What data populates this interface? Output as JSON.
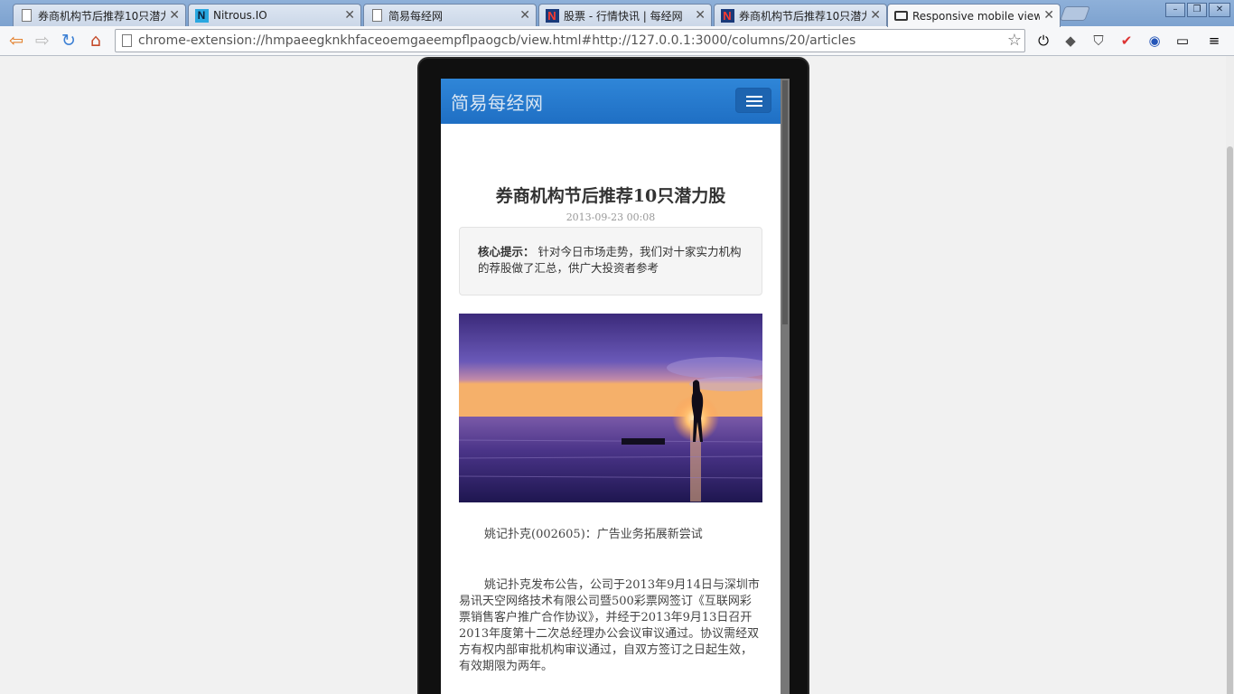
{
  "tabs": [
    {
      "title": "券商机构节后推荐10只潜力",
      "favicon": "page-icon"
    },
    {
      "title": "Nitrous.IO",
      "favicon": "nitrous-icon"
    },
    {
      "title": "简易每经网",
      "favicon": "page-icon"
    },
    {
      "title": "股票 - 行情快讯 | 每经网",
      "favicon": "nbd-icon"
    },
    {
      "title": "券商机构节后推荐10只潜力",
      "favicon": "nbd-icon"
    },
    {
      "title": "Responsive mobile view",
      "favicon": "responsive-icon",
      "active": true
    }
  ],
  "toolbar": {
    "url": "chrome-extension://hmpaeegknkhfaceoemgaeempflpaogcb/view.html#http://127.0.0.1:3000/columns/20/articles"
  },
  "app": {
    "brand": "简易每经网",
    "article": {
      "title": "券商机构节后推荐10只潜力股",
      "date": "2013-09-23 00:08",
      "summary_label": "核心提示：",
      "summary_text": "针对今日市场走势，我们对十家实力机构的荐股做了汇总，供广大投资者参考",
      "para1": "姚记扑克(002605)：广告业务拓展新尝试",
      "para2": "姚记扑克发布公告，公司于2013年9月14日与深圳市易讯天空网络技术有限公司暨500彩票网签订《互联网彩票销售客户推广合作协议》，并经于2013年9月13日召开2013年度第十二次总经理办公会议审议通过。协议需经双方有权内部审批机构审议通过，自双方签订之日起生效，有效期限为两年。"
    }
  }
}
